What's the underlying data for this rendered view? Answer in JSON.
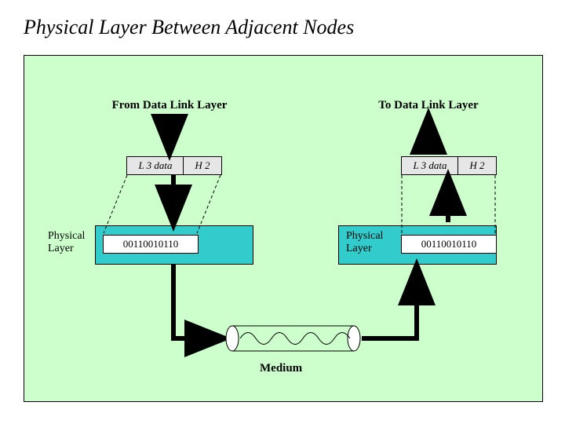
{
  "title": "Physical Layer Between Adjacent Nodes",
  "left": {
    "topLabel": "From Data Link Layer",
    "l3": "L 3 data",
    "h2": "H 2",
    "bits": "00110010110",
    "phyLabel1": "Physical",
    "phyLabel2": "Layer"
  },
  "right": {
    "topLabel": "To Data Link Layer",
    "l3": "L 3 data",
    "h2": "H 2",
    "bits": "00110010110",
    "phyLabel1": "Physical",
    "phyLabel2": "Layer"
  },
  "mediumLabel": "Medium"
}
